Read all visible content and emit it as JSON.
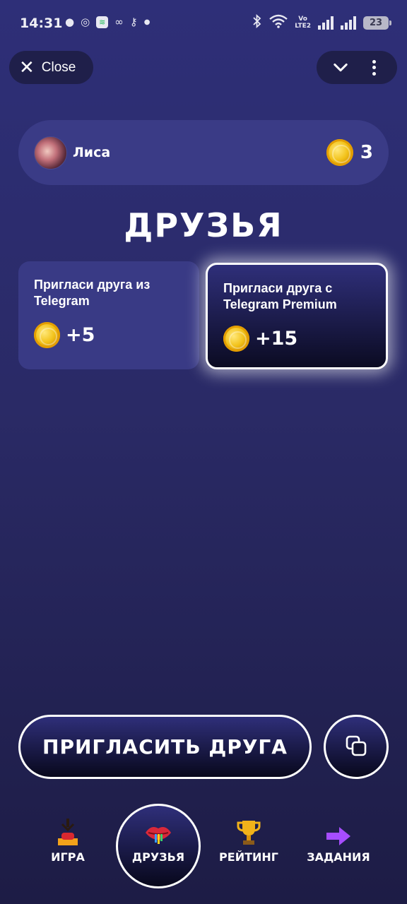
{
  "status_bar": {
    "time": "14:31",
    "battery": "23",
    "volte_top": "Vo",
    "volte_bottom": "LTE2"
  },
  "header": {
    "close_label": "Close",
    "icons": [
      "close-icon",
      "chevron-down-icon",
      "more-vertical-icon"
    ]
  },
  "user": {
    "name": "Лиса",
    "coins": "3"
  },
  "page": {
    "title": "ДРУЗЬЯ"
  },
  "invite_options": [
    {
      "title": "Пригласи друга из Telegram",
      "reward": "+5"
    },
    {
      "title": "Пригласи друга с Telegram Premium",
      "reward": "+15"
    }
  ],
  "actions": {
    "invite_label": "ПРИГЛАСИТЬ ДРУГА",
    "copy_icon": "copy-icon"
  },
  "nav": {
    "items": [
      {
        "label": "ИГРА",
        "icon": "game-icon"
      },
      {
        "label": "ДРУЗЬЯ",
        "icon": "lips-icon",
        "active": true
      },
      {
        "label": "РЕЙТИНГ",
        "icon": "trophy-icon"
      },
      {
        "label": "ЗАДАНИЯ",
        "icon": "arrow-right-icon"
      }
    ]
  },
  "colors": {
    "background_top": "#2e2f78",
    "background_bottom": "#1d1c45",
    "card": "#393a85",
    "coin": "#f2c21a",
    "accent_arrow": "#a64dff",
    "trophy": "#f2b21a"
  }
}
